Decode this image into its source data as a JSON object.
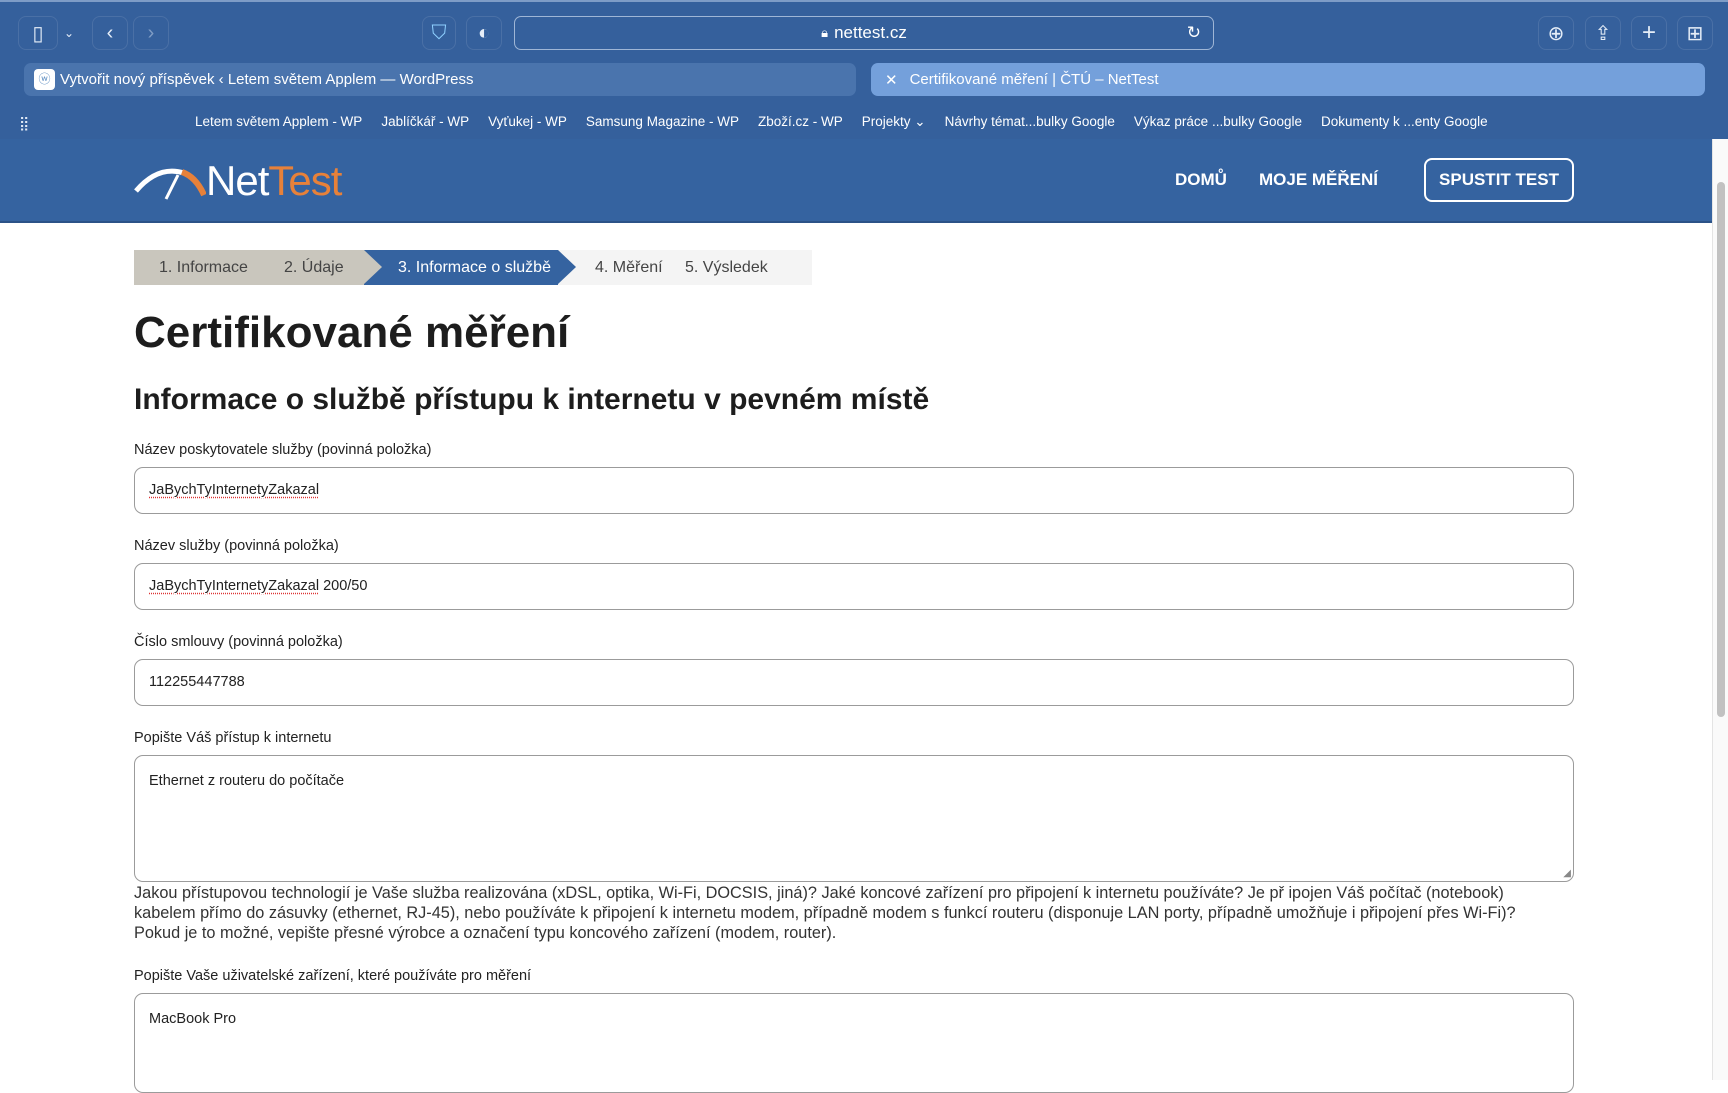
{
  "browser": {
    "url": "nettest.cz",
    "tabs": [
      {
        "title": "Vytvořit nový příspěvek ‹ Letem světem Applem — WordPress"
      },
      {
        "title": "Certifikované měření | ČTÚ – NetTest"
      }
    ],
    "bookmarks": [
      "Letem světem Applem - WP",
      "Jablíčkář - WP",
      "Vyťukej - WP",
      "Samsung Magazine - WP",
      "Zboží.cz - WP",
      "Projekty ⌄",
      "Návrhy témat...bulky Google",
      "Výkaz práce ...bulky Google",
      "Dokumenty k ...enty Google"
    ]
  },
  "site": {
    "logo_a": "Net",
    "logo_b": "Test",
    "nav": {
      "home": "DOMŮ",
      "my": "MOJE MĚŘENÍ",
      "run": "SPUSTIT TEST"
    }
  },
  "steps": [
    "1. Informace",
    "2. Údaje",
    "3. Informace o službě",
    "4. Měření",
    "5. Výsledek"
  ],
  "page": {
    "title": "Certifikované měření",
    "subtitle": "Informace o službě přístupu k internetu v pevném místě",
    "fields": [
      {
        "label": "Název poskytovatele služby (povinná položka)",
        "value": "JaBychTyInternetyZakazal"
      },
      {
        "label": "Název služby (povinná položka)",
        "value_a": "JaBychTyInternetyZakazal",
        "value_b": " 200/50"
      },
      {
        "label": "Číslo smlouvy (povinná položka)",
        "value": "112255447788"
      },
      {
        "label": "Popište Váš přístup k internetu",
        "value": "Ethernet z routeru do počítače"
      },
      {
        "label": "Popište Vaše uživatelské zařízení, které používáte pro měření",
        "value": "MacBook Pro"
      }
    ],
    "help": [
      "Jakou přístupovou technologií je Vaše služba realizována (xDSL, optika, Wi-Fi, DOCSIS, jiná)? Jaké koncové zařízení pro připojení k internetu používáte? Je př ipojen Váš počítač (notebook)",
      "kabelem přímo do zásuvky (ethernet, RJ-45), nebo používáte k připojení k internetu modem, případně modem s funkcí routeru (disponuje LAN porty, případně umožňuje i připojení přes Wi-Fi)?",
      "Pokud je to možné, vepište přesné výrobce a označení typu koncového zařízení (modem, router)."
    ]
  }
}
